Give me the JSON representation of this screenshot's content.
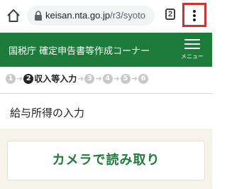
{
  "browser": {
    "url_domain": "keisan.nta.go.jp",
    "url_path": "/r3/syoto",
    "tab_count": "2"
  },
  "header": {
    "title": "国税庁 確定申告書等作成コーナー",
    "menu_label": "メニュー",
    "background_color": "#1e7c3b"
  },
  "steps": {
    "items": [
      {
        "number": "1",
        "label": ""
      },
      {
        "number": "2",
        "label": "収入等入力"
      },
      {
        "number": "3",
        "label": ""
      },
      {
        "number": "4",
        "label": ""
      },
      {
        "number": "5",
        "label": ""
      },
      {
        "number": "6",
        "label": ""
      }
    ],
    "current": 2
  },
  "page": {
    "title": "給与所得の入力"
  },
  "camera": {
    "button_label": "カメラで読み取り"
  }
}
